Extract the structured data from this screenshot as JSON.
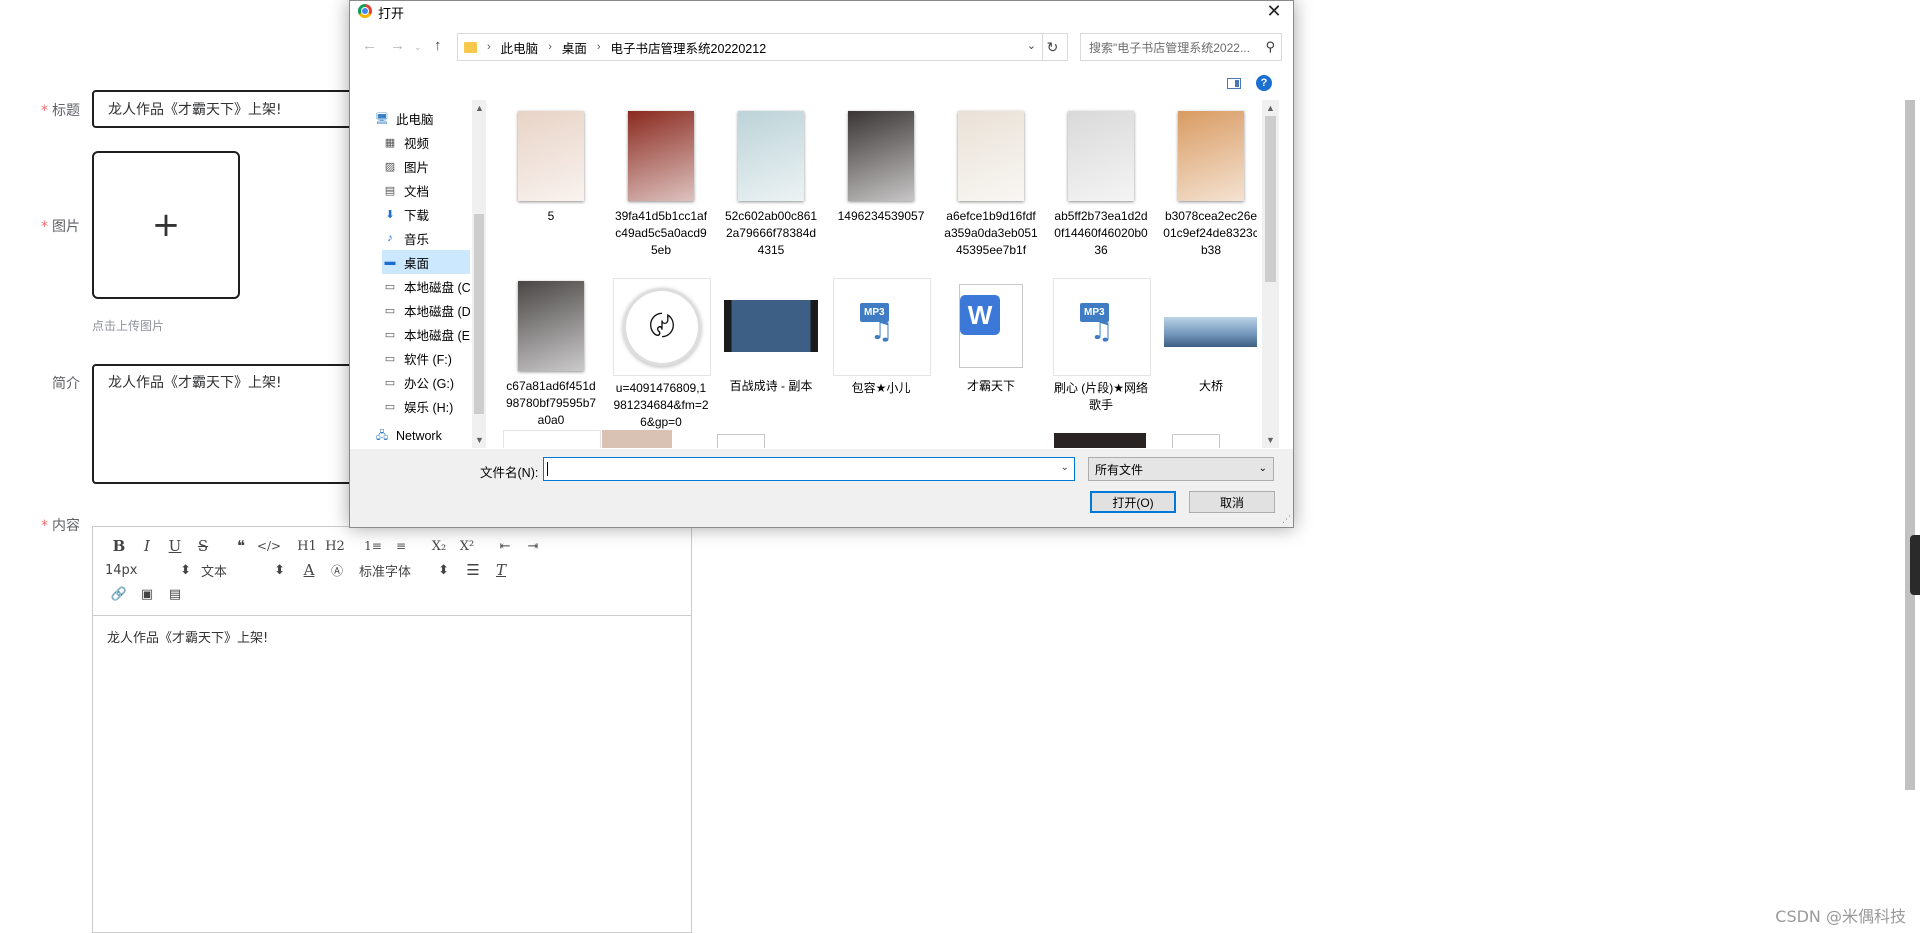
{
  "form": {
    "title_label": "标题",
    "title_value": "龙人作品《才霸天下》上架!",
    "image_label": "图片",
    "upload_plus": "+",
    "upload_tip": "点击上传图片",
    "intro_label": "简介",
    "intro_value": "龙人作品《才霸天下》上架!",
    "content_label": "内容",
    "required_mark": "*"
  },
  "editor": {
    "toolbar1": [
      "B",
      "I",
      "U",
      "S",
      "❝",
      "</>",
      "H1",
      "H2",
      "1≡",
      "≡",
      "X₂",
      "X²",
      "⇤",
      "⇥"
    ],
    "font_size": "14px",
    "block_type": "文本",
    "font_family": "标准字体",
    "content": "龙人作品《才霸天下》上架!"
  },
  "watermark": "CSDN @米偶科技",
  "dialog": {
    "title": "打开",
    "close": "✕",
    "breadcrumb": [
      "此电脑",
      "桌面",
      "电子书店管理系统20220212"
    ],
    "search_placeholder": "搜索\"电子书店管理系统2022...",
    "help": "?",
    "nav_items": [
      {
        "label": "此电脑",
        "icon": "computer-icon"
      },
      {
        "label": "视频",
        "icon": "video-icon"
      },
      {
        "label": "图片",
        "icon": "pictures-icon"
      },
      {
        "label": "文档",
        "icon": "documents-icon"
      },
      {
        "label": "下载",
        "icon": "downloads-icon"
      },
      {
        "label": "音乐",
        "icon": "music-icon"
      },
      {
        "label": "桌面",
        "icon": "desktop-icon"
      },
      {
        "label": "本地磁盘 (C:",
        "icon": "drive-icon"
      },
      {
        "label": "本地磁盘 (D:",
        "icon": "drive-icon"
      },
      {
        "label": "本地磁盘 (E:",
        "icon": "drive-icon"
      },
      {
        "label": "软件 (F:)",
        "icon": "drive-icon"
      },
      {
        "label": "办公 (G:)",
        "icon": "drive-icon"
      },
      {
        "label": "娱乐 (H:)",
        "icon": "drive-icon"
      },
      {
        "label": "Network",
        "icon": "network-icon"
      }
    ],
    "files_row1": [
      {
        "name": "5",
        "cover": "#e8d3c6"
      },
      {
        "name": "39fa41d5b1cc1afc49ad5c5a0acd95eb",
        "cover": "#8a2a1f"
      },
      {
        "name": "52c602ab00c8612a79666f78384d4315",
        "cover": "#bcd3d8"
      },
      {
        "name": "1496234539057",
        "cover": "#3b3535"
      },
      {
        "name": "a6efce1b9d16fdfa359a0da3eb05145395ee7b1f",
        "cover": "#e9e1d6"
      },
      {
        "name": "ab5ff2b73ea1d2d0f14460f46020b036",
        "cover": "#d9d9d9"
      },
      {
        "name": "b3078cea2ec26e01c9ef24de8323cb38",
        "cover": "#d99b62"
      }
    ],
    "files_row2": [
      {
        "name": "c67a81ad6f451d98780bf79595b7a0a0",
        "kind": "cover",
        "cover": "#4a4646"
      },
      {
        "name": "u=4091476809,1981234684&fm=26&gp=0",
        "kind": "logo"
      },
      {
        "name": "百战成诗 - 副本",
        "kind": "video"
      },
      {
        "name": "包容★小儿",
        "kind": "mp3"
      },
      {
        "name": "才霸天下",
        "kind": "wps"
      },
      {
        "name": "刷心 (片段)★网络歌手",
        "kind": "mp3"
      },
      {
        "name": "大桥",
        "kind": "photo"
      }
    ],
    "filename_label": "文件名(N):",
    "filename_value": "",
    "filter_value": "所有文件",
    "open_button": "打开(O)",
    "cancel_button": "取消"
  }
}
